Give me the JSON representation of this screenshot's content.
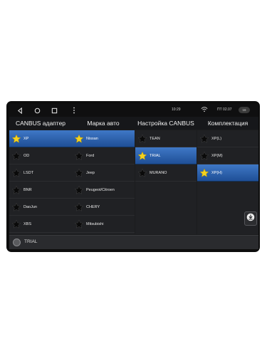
{
  "statusbar": {
    "time": "10:29",
    "day": "ПТ 02.07",
    "battery": "16"
  },
  "headers": [
    "CANBUS адаптер",
    "Марка авто",
    "Настройка CANBUS",
    "Комплектация"
  ],
  "columns": {
    "adapter": [
      {
        "label": "XP",
        "selected": true
      },
      {
        "label": "OD",
        "selected": false
      },
      {
        "label": "LSDT",
        "selected": false
      },
      {
        "label": "BNR",
        "selected": false
      },
      {
        "label": "DaoJun",
        "selected": false
      },
      {
        "label": "XBS",
        "selected": false
      }
    ],
    "brand": [
      {
        "label": "Nissan",
        "selected": true
      },
      {
        "label": "Ford",
        "selected": false
      },
      {
        "label": "Jeep",
        "selected": false
      },
      {
        "label": "Peugeot/Citroen",
        "selected": false
      },
      {
        "label": "CHERY",
        "selected": false
      },
      {
        "label": "Mitsubishi",
        "selected": false
      }
    ],
    "canbus_setting": [
      {
        "label": "TEAN",
        "selected": false
      },
      {
        "label": "TRIAL",
        "selected": true
      },
      {
        "label": "MURANO",
        "selected": false
      }
    ],
    "trim": [
      {
        "label": "XP(L)",
        "selected": false
      },
      {
        "label": "XP(M)",
        "selected": false
      },
      {
        "label": "XP(H)",
        "selected": true
      }
    ]
  },
  "bottombar": {
    "current": "TRIAL"
  },
  "colors": {
    "selected_top": "#3f78c6",
    "selected_bottom": "#1f4f97",
    "star_selected": "#f5d21f",
    "star_normal": "#0a0a0a"
  },
  "icons": {
    "nav": [
      "back-icon",
      "home-icon",
      "recents-icon",
      "menu-dots-icon"
    ],
    "status": [
      "wifi-icon",
      "battery-icon"
    ],
    "list": "star-icon",
    "bottom": "circle-icon",
    "fab": "download-icon"
  }
}
